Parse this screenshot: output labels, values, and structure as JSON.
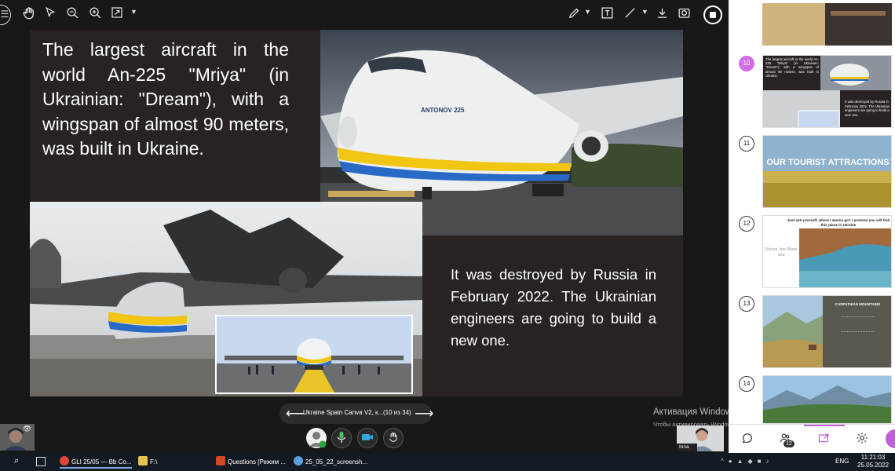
{
  "toolbar": {
    "left_icons": [
      "hand-icon",
      "pointer-icon",
      "zoom-out-icon",
      "zoom-in-icon",
      "fit-icon"
    ],
    "right_icons": [
      "pen-icon",
      "text-box-icon",
      "line-icon",
      "download-icon",
      "screenshot-icon",
      "stop-sharing-icon"
    ]
  },
  "slide": {
    "text_1": "The largest aircraft in the world An-225 \"Mriya\" (in Ukrainian: \"Dream\"), with a wingspan of almost 90 meters, was built in Ukraine.",
    "text_2": "It was destroyed by Russia in February 2022. The Ukrainian engineers are going to build a new one.",
    "aircraft_lettering": "ANTONOV 225"
  },
  "slide_nav": {
    "deck_title": "Ukraine Spain Canva V2, к...",
    "slide_count": "(10 из 34)",
    "prev_icon": "arrow-left-icon",
    "next_icon": "arrow-right-icon"
  },
  "watermark": {
    "title": "Активация Windows",
    "subtitle": "Чтобы активировать Windows, перейдите в раздел \"Параметры\"."
  },
  "participants": {
    "remote_name": "Inna",
    "count": "12"
  },
  "thumbnails": [
    {
      "num": "10",
      "active": true,
      "text_a": "The largest aircraft in the world An-225 \"Mriya\" (in Ukrainian: \"Dream\"), with a wingspan of almost 90 meters, was built in Ukraine.",
      "text_b": "It was destroyed by Russia in February 2022. The Ukrainian engineers are going to build a new one."
    },
    {
      "num": "11",
      "active": false,
      "title": "OUR TOURIST ATTRACTIONS"
    },
    {
      "num": "12",
      "active": false,
      "heading": "Just ask yourself, where I wanna go? I promise you will find this place in Ukraine",
      "caption": "Odesa, the Black sea"
    },
    {
      "num": "13",
      "active": false,
      "title": "CARPATHIAN MOUNTAINS"
    },
    {
      "num": "14",
      "active": false
    }
  ],
  "taskbar": {
    "apps": [
      {
        "label": "GLI 25/05 — Bb Co...",
        "color": "#e0443a"
      },
      {
        "label": "F:\\",
        "color": "#e8c14a"
      },
      {
        "label": "Questions [Режим ...",
        "color": "#d24726"
      },
      {
        "label": "25_05_22_screensh...",
        "color": "#5aa0e0"
      }
    ],
    "lang": "ENG",
    "time": "11:21:03",
    "date": "25.05.2022"
  }
}
